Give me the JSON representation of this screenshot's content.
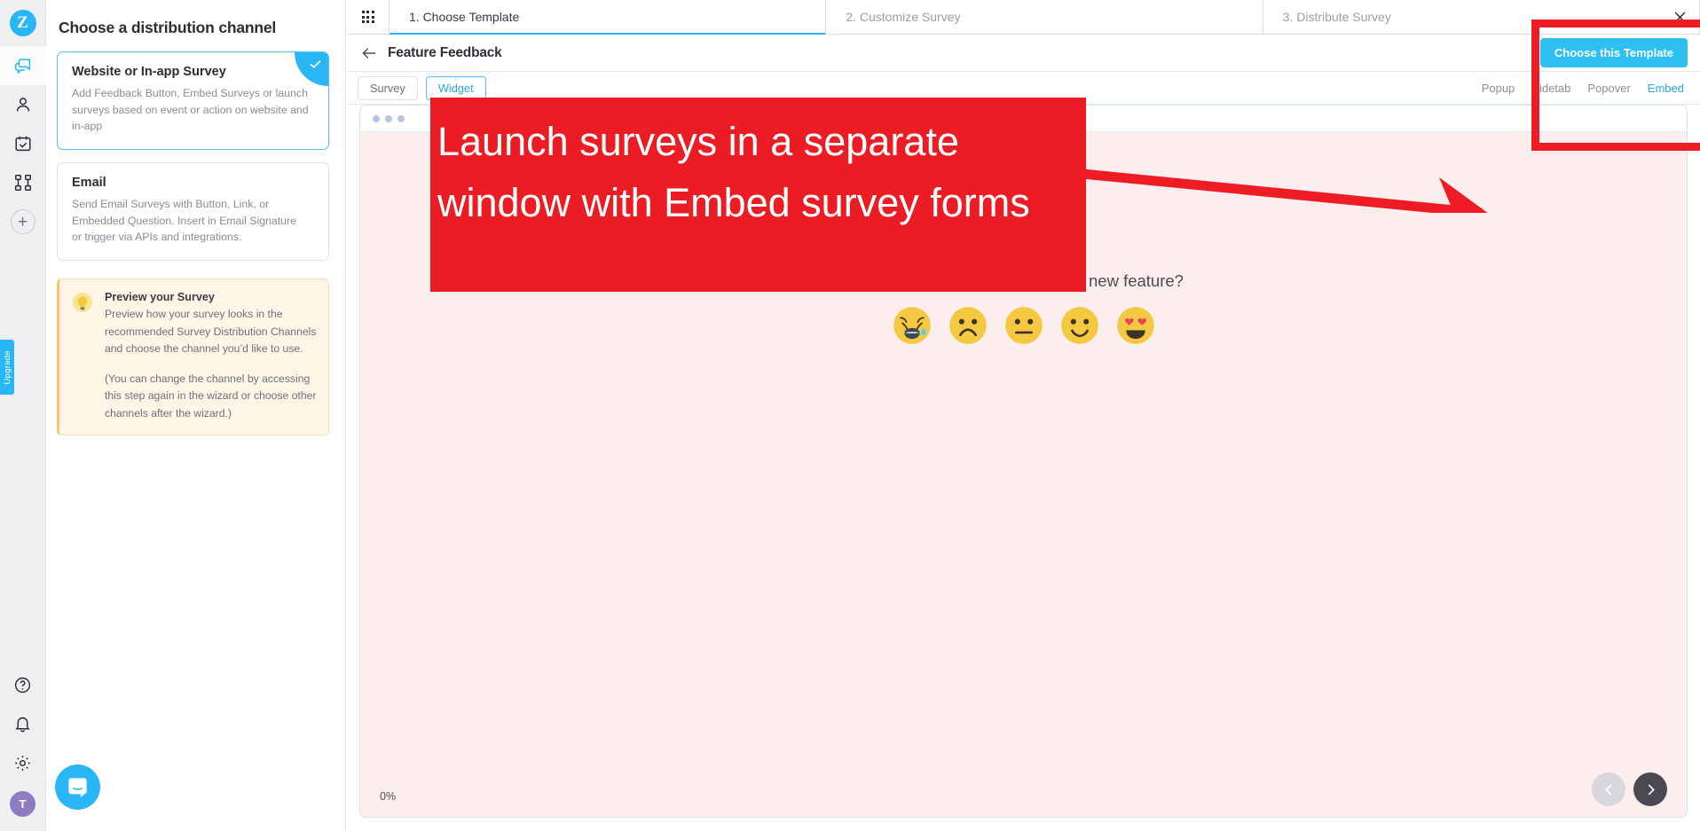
{
  "rail": {
    "logo_letter": "Z",
    "items": [
      {
        "name": "chat-icon",
        "label": "Feedback"
      },
      {
        "name": "user-icon",
        "label": "Contacts"
      },
      {
        "name": "calendar-check-icon",
        "label": "Surveys"
      },
      {
        "name": "workflow-icon",
        "label": "Workflows"
      },
      {
        "name": "plus-icon",
        "label": "+"
      }
    ],
    "bottom_items": [
      {
        "name": "help-icon",
        "label": "Help"
      },
      {
        "name": "bell-icon",
        "label": "Notifications"
      },
      {
        "name": "gear-icon",
        "label": "Settings"
      }
    ],
    "upgrade_label": "Upgrade",
    "avatar_initial": "T"
  },
  "left_panel": {
    "title": "Choose a distribution channel",
    "channels": [
      {
        "title": "Website or In-app Survey",
        "desc": "Add Feedback Button, Embed Surveys or launch surveys based on event or action on website and in-app",
        "selected": true
      },
      {
        "title": "Email",
        "desc": "Send Email Surveys with Button, Link, or Embedded Question. Insert in Email Signature or trigger via APIs and integrations.",
        "selected": false
      }
    ],
    "tip": {
      "title": "Preview your Survey",
      "text1": "Preview how your survey looks in the recommended Survey Distribution Channels and choose the channel you’d like to use.",
      "text2": "(You can change the channel by accessing this step again in the wizard or choose other channels after the wizard.)"
    }
  },
  "wizard": {
    "grid_icon": "grid-icon",
    "steps": [
      {
        "label": "1. Choose Template",
        "active": true
      },
      {
        "label": "2. Customize Survey",
        "active": false
      },
      {
        "label": "3. Distribute Survey",
        "active": false
      }
    ],
    "close_label": "×"
  },
  "template_header": {
    "back_icon": "back-arrow-icon",
    "name": "Feature Feedback",
    "choose_button": "Choose this Template"
  },
  "tab_row": {
    "tabs": [
      {
        "label": "Survey",
        "active": false
      },
      {
        "label": "Widget",
        "active": true
      }
    ],
    "widget_modes": [
      {
        "label": "Popup",
        "active": false
      },
      {
        "label": "Sidetab",
        "active": false
      },
      {
        "label": "Popover",
        "active": false
      },
      {
        "label": "Embed",
        "active": true
      }
    ]
  },
  "preview": {
    "question": "How satisfied are you with this new feature?",
    "emojis": [
      {
        "name": "crying-face-emoji",
        "value": 1
      },
      {
        "name": "frowning-face-emoji",
        "value": 2
      },
      {
        "name": "neutral-face-emoji",
        "value": 3
      },
      {
        "name": "slightly-smiling-face-emoji",
        "value": 4
      },
      {
        "name": "heart-eyes-face-emoji",
        "value": 5
      }
    ],
    "progress": "0%",
    "prev_label": "‹",
    "next_label": "›"
  },
  "annotation": {
    "banner_text": "Launch surveys in a separate window with Embed survey forms",
    "color": "#ec1c24"
  },
  "colors": {
    "accent": "#29b6f6",
    "annotation_red": "#ec1c24",
    "tip_bg": "#fdf6e7",
    "preview_bg": "#fdeeee"
  }
}
